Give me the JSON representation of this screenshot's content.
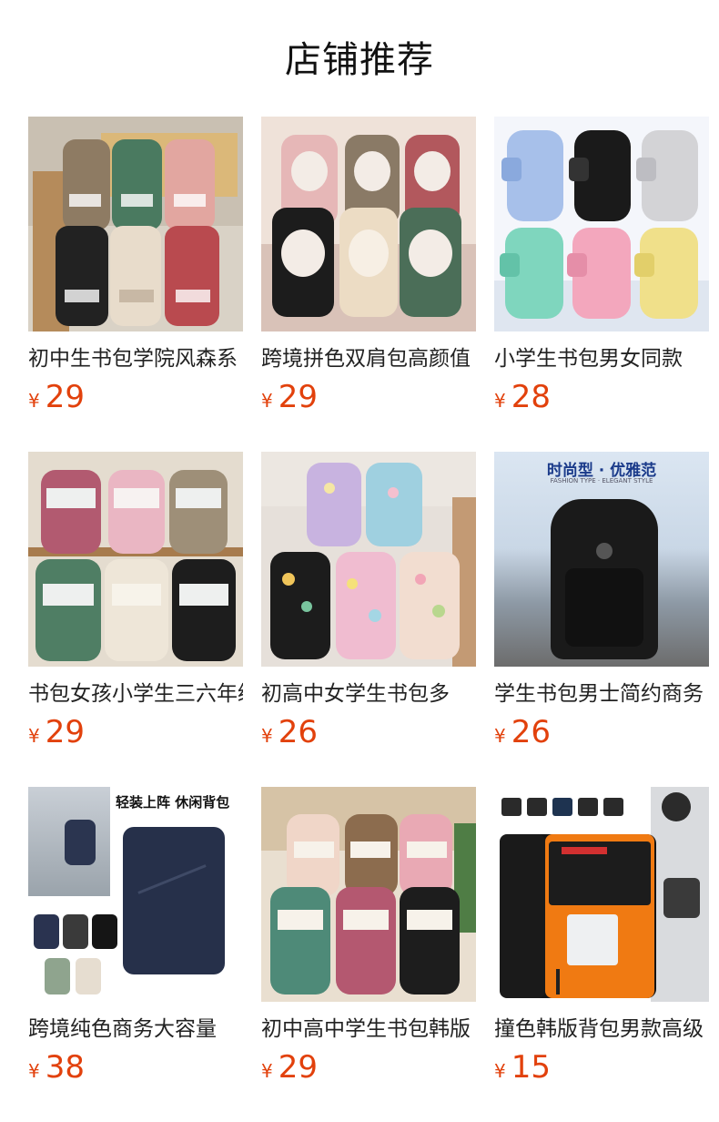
{
  "header": {
    "title": "店铺推荐"
  },
  "currency_symbol": "¥",
  "products": [
    {
      "title": "初中生书包学院风森系",
      "price": "29",
      "image": "backpack-set-six-earth-tones"
    },
    {
      "title": "跨境拼色双肩包高颜值",
      "price": "29",
      "image": "backpack-set-six-pastel"
    },
    {
      "title": "小学生书包男女同款",
      "price": "28",
      "image": "backpack-set-six-colors"
    },
    {
      "title": "书包女孩小学生三六年级",
      "price": "29",
      "image": "backpack-set-six-two-tone"
    },
    {
      "title": "初高中女学生书包多",
      "price": "26",
      "image": "backpack-set-cartoon-print"
    },
    {
      "title": "学生书包男士简约商务",
      "price": "26",
      "image": "black-business-backpack",
      "overlay_title": "时尚型 · 优雅范",
      "overlay_sub": "FASHION TYPE · ELEGANT STYLE"
    },
    {
      "title": "跨境纯色商务大容量",
      "price": "38",
      "image": "navy-laptop-backpack",
      "overlay_title": "轻装上阵 休闲背包"
    },
    {
      "title": "初中高中学生书包韩版",
      "price": "29",
      "image": "backpack-set-six-mixed"
    },
    {
      "title": "撞色韩版背包男款高级",
      "price": "15",
      "image": "orange-black-shoulder-bag"
    }
  ],
  "colors": {
    "price": "#e2410c",
    "title": "#222222"
  }
}
